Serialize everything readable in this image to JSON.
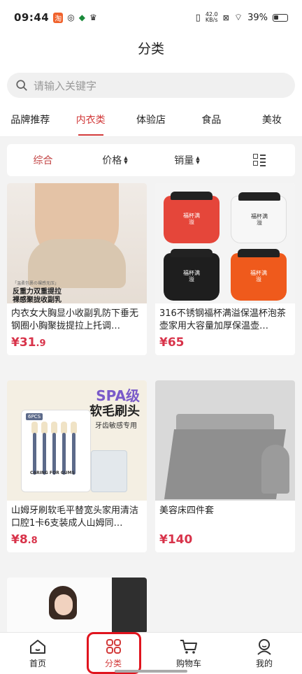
{
  "status_bar": {
    "time": "09:44",
    "net_speed": "42.0",
    "net_unit": "KB/s",
    "battery": "39%"
  },
  "header": {
    "title": "分类"
  },
  "search": {
    "placeholder": "请输入关键字"
  },
  "categories": [
    {
      "label": "品牌推荐"
    },
    {
      "label": "内衣类",
      "active": true
    },
    {
      "label": "体验店"
    },
    {
      "label": "食品"
    },
    {
      "label": "美妆"
    }
  ],
  "sort_bar": {
    "comprehensive": "综合",
    "price": "价格",
    "sales": "销量"
  },
  "products": [
    {
      "title": "内衣女大胸显小收副乳防下垂无钢圈小胸聚拢提拉上托调…",
      "price_int": "¥31",
      "price_dec": ".9",
      "overlay_line1": "反重力双重提拉",
      "overlay_line2": "裸感聚拢收副乳",
      "overlay_small": "「温柔包裹の裸感无压」"
    },
    {
      "title": "316不锈钢福杯满溢保温杯泡茶壶家用大容量加厚保温壶…",
      "price_int": "¥65",
      "price_dec": "",
      "pot_label": "福杯满溢"
    },
    {
      "title": "山姆牙刷软毛平替宽头家用清洁口腔1卡6支装成人山姆同…",
      "price_int": "¥8",
      "price_dec": ".8",
      "badge": "SPA级",
      "headline": "软毛刷头",
      "sub": "牙齿敏感专用",
      "pack_count": "6PCS",
      "pack_text": "CARING FOR GUMS"
    },
    {
      "title": "美容床四件套",
      "price_int": "¥140",
      "price_dec": ""
    }
  ],
  "bottom_nav": [
    {
      "label": "首页",
      "icon": "home-icon"
    },
    {
      "label": "分类",
      "icon": "category-icon",
      "active": true
    },
    {
      "label": "购物车",
      "icon": "cart-icon"
    },
    {
      "label": "我的",
      "icon": "profile-icon"
    }
  ],
  "colors": {
    "accent": "#d23a3a",
    "price": "#d8334a",
    "highlight_box": "#e0141e"
  }
}
